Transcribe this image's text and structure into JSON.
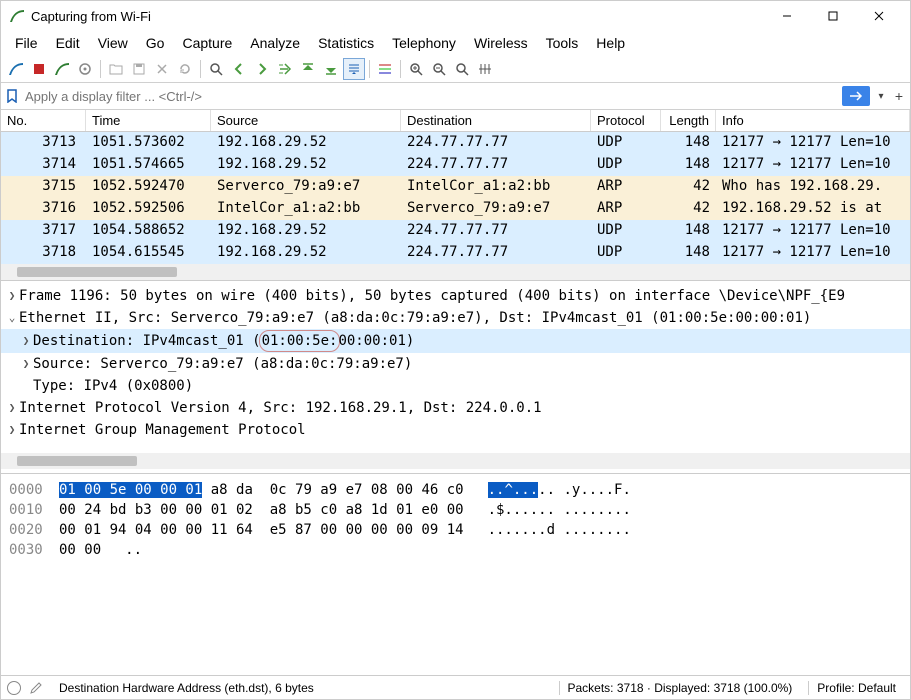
{
  "window": {
    "title": "Capturing from Wi-Fi"
  },
  "menu": {
    "file": "File",
    "edit": "Edit",
    "view": "View",
    "go": "Go",
    "capture": "Capture",
    "analyze": "Analyze",
    "statistics": "Statistics",
    "telephony": "Telephony",
    "wireless": "Wireless",
    "tools": "Tools",
    "help": "Help"
  },
  "filter": {
    "placeholder": "Apply a display filter ... <Ctrl-/>"
  },
  "columns": {
    "no": "No.",
    "time": "Time",
    "source": "Source",
    "destination": "Destination",
    "protocol": "Protocol",
    "length": "Length",
    "info": "Info"
  },
  "packets": [
    {
      "no": "3713",
      "time": "1051.573602",
      "src": "192.168.29.52",
      "dst": "224.77.77.77",
      "proto": "UDP",
      "len": "148",
      "info": "12177 → 12177 Len=10",
      "cls": "row-udp"
    },
    {
      "no": "3714",
      "time": "1051.574665",
      "src": "192.168.29.52",
      "dst": "224.77.77.77",
      "proto": "UDP",
      "len": "148",
      "info": "12177 → 12177 Len=10",
      "cls": "row-udp"
    },
    {
      "no": "3715",
      "time": "1052.592470",
      "src": "Serverco_79:a9:e7",
      "dst": "IntelCor_a1:a2:bb",
      "proto": "ARP",
      "len": "42",
      "info": "Who has 192.168.29.",
      "cls": "row-arp"
    },
    {
      "no": "3716",
      "time": "1052.592506",
      "src": "IntelCor_a1:a2:bb",
      "dst": "Serverco_79:a9:e7",
      "proto": "ARP",
      "len": "42",
      "info": "192.168.29.52 is at",
      "cls": "row-arp"
    },
    {
      "no": "3717",
      "time": "1054.588652",
      "src": "192.168.29.52",
      "dst": "224.77.77.77",
      "proto": "UDP",
      "len": "148",
      "info": "12177 → 12177 Len=10",
      "cls": "row-udp"
    },
    {
      "no": "3718",
      "time": "1054.615545",
      "src": "192.168.29.52",
      "dst": "224.77.77.77",
      "proto": "UDP",
      "len": "148",
      "info": "12177 → 12177 Len=10",
      "cls": "row-udp"
    }
  ],
  "details": {
    "frame": "Frame 1196: 50 bytes on wire (400 bits), 50 bytes captured (400 bits) on interface \\Device\\NPF_{E9",
    "eth": "Ethernet II, Src: Serverco_79:a9:e7 (a8:da:0c:79:a9:e7), Dst: IPv4mcast_01 (01:00:5e:00:00:01)",
    "dst_a": "Destination: IPv4mcast_01 (",
    "dst_b": "01:00:5e:",
    "dst_c": "00:00:01)",
    "src": "Source: Serverco_79:a9:e7 (a8:da:0c:79:a9:e7)",
    "type": "Type: IPv4 (0x0800)",
    "ip": "Internet Protocol Version 4, Src: 192.168.29.1, Dst: 224.0.0.1",
    "igmp": "Internet Group Management Protocol"
  },
  "hex": {
    "r0": {
      "off": "0000",
      "sel": "01 00 5e 00 00 01",
      "rest": " a8 da  0c 79 a9 e7 08 00 46 c0",
      "asc_sel": "..^...",
      "asc_rest": ".. .y....F."
    },
    "r1": {
      "off": "0010",
      "bytes": "00 24 bd b3 00 00 01 02  a8 b5 c0 a8 1d 01 e0 00",
      "asc": ".$...... ........"
    },
    "r2": {
      "off": "0020",
      "bytes": "00 01 94 04 00 00 11 64  e5 87 00 00 00 00 09 14",
      "asc": ".......d ........"
    },
    "r3": {
      "off": "0030",
      "bytes": "00 00",
      "asc": ".."
    }
  },
  "status": {
    "field": "Destination Hardware Address (eth.dst), 6 bytes",
    "packets": "Packets: 3718 · Displayed: 3718 (100.0%)",
    "profile": "Profile: Default"
  }
}
